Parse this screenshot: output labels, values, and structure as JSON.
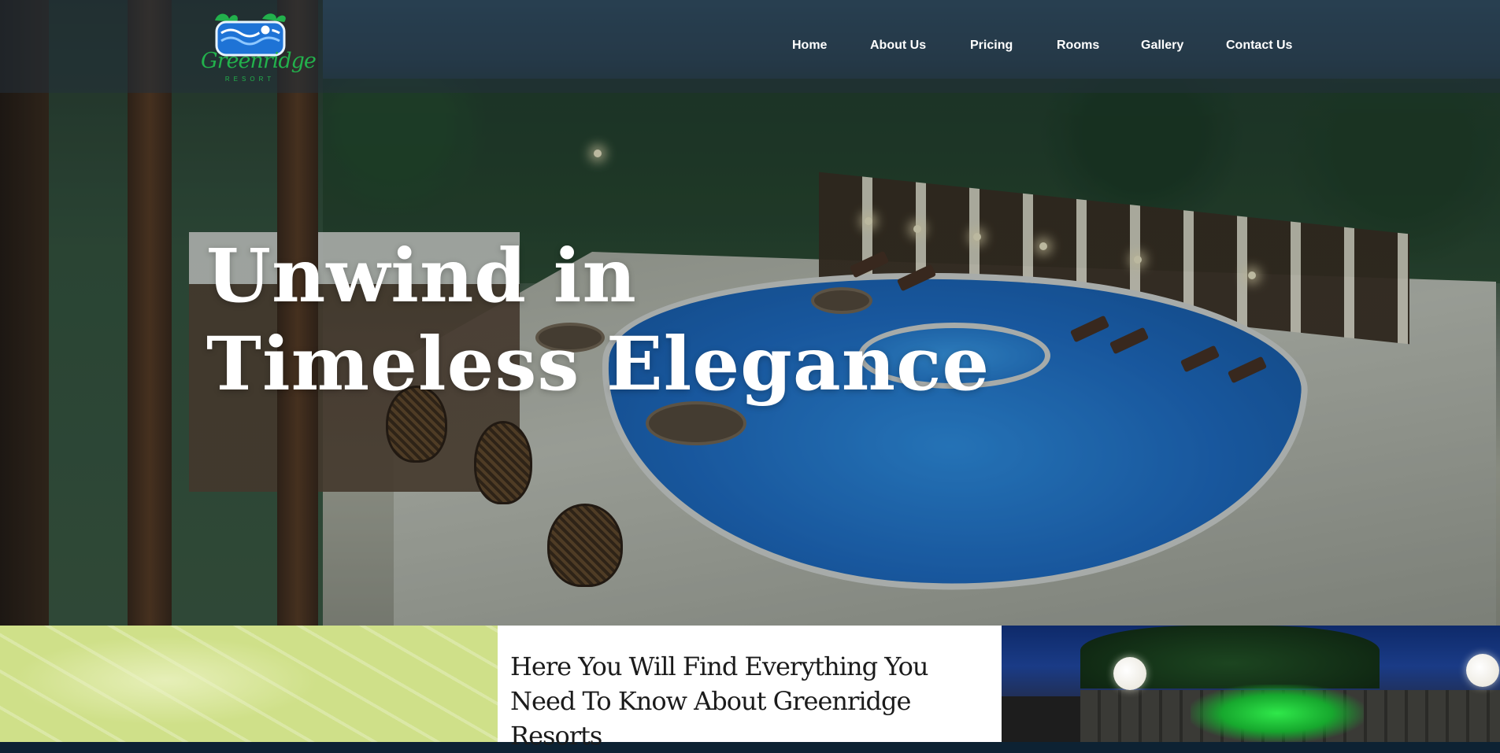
{
  "brand": {
    "name": "Greenridge",
    "tagline": "RESORT",
    "colors": {
      "logo_green": "#22b14c",
      "logo_blue": "#1e73d6",
      "accent_lime": "#cfe089"
    }
  },
  "nav": {
    "items": [
      {
        "label": "Home"
      },
      {
        "label": "About Us"
      },
      {
        "label": "Pricing"
      },
      {
        "label": "Rooms"
      },
      {
        "label": "Gallery"
      },
      {
        "label": "Contact Us"
      }
    ]
  },
  "hero": {
    "headline_line1": "Unwind in",
    "headline_line2": "Timeless Elegance"
  },
  "intro": {
    "heading": "Here You Will Find Everything You Need To Know About Greenridge Resorts"
  }
}
